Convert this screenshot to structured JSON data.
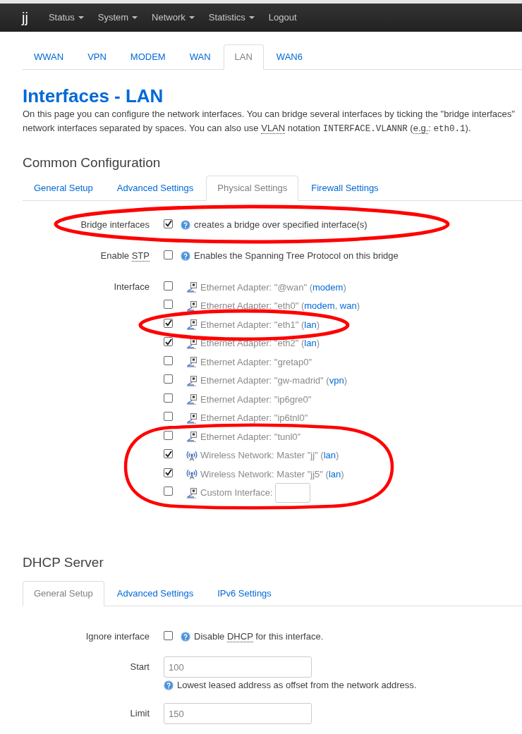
{
  "navbar": {
    "brand": "jj",
    "menu": [
      {
        "label": "Status",
        "dropdown": true
      },
      {
        "label": "System",
        "dropdown": true
      },
      {
        "label": "Network",
        "dropdown": true
      },
      {
        "label": "Statistics",
        "dropdown": true
      },
      {
        "label": "Logout",
        "dropdown": false
      }
    ]
  },
  "interface_tabs": [
    {
      "label": "WWAN",
      "selected": false
    },
    {
      "label": "VPN",
      "selected": false
    },
    {
      "label": "MODEM",
      "selected": false
    },
    {
      "label": "WAN",
      "selected": false
    },
    {
      "label": "LAN",
      "selected": true
    },
    {
      "label": "WAN6",
      "selected": false
    }
  ],
  "page": {
    "title": "Interfaces - LAN",
    "description_lines": [
      [
        {
          "kind": "text",
          "text": "On this page you can configure the network interfaces. You can bridge several interfaces by ticking the \"bridge interfaces\""
        }
      ],
      [
        {
          "kind": "text",
          "text": "network interfaces separated by spaces. You can also use "
        },
        {
          "kind": "abbr",
          "text": "VLAN"
        },
        {
          "kind": "text",
          "text": " notation "
        },
        {
          "kind": "code",
          "text": "INTERFACE.VLANNR"
        },
        {
          "kind": "text",
          "text": " ("
        },
        {
          "kind": "abbr",
          "text": "e.g."
        },
        {
          "kind": "text",
          "text": ": "
        },
        {
          "kind": "code",
          "text": "eth0.1"
        },
        {
          "kind": "text",
          "text": ")."
        }
      ]
    ]
  },
  "sections": [
    {
      "heading": "Common Configuration",
      "tabs": [
        {
          "label": "General Setup",
          "selected": false
        },
        {
          "label": "Advanced Settings",
          "selected": false
        },
        {
          "label": "Physical Settings",
          "selected": true
        },
        {
          "label": "Firewall Settings",
          "selected": false
        }
      ],
      "fields": [
        {
          "kind": "checkbox",
          "label": [
            {
              "kind": "text",
              "text": "Bridge interfaces"
            }
          ],
          "checked": true,
          "help": [
            {
              "kind": "text",
              "text": "creates a bridge over specified interface(s)"
            }
          ]
        },
        {
          "kind": "checkbox",
          "label": [
            {
              "kind": "text",
              "text": "Enable "
            },
            {
              "kind": "abbr",
              "text": "STP"
            }
          ],
          "checked": false,
          "help": [
            {
              "kind": "text",
              "text": "Enables the Spanning Tree Protocol on this bridge"
            }
          ]
        },
        {
          "kind": "interface_list",
          "label": [
            {
              "kind": "text",
              "text": "Interface"
            }
          ],
          "options": [
            {
              "kind": "ethernet",
              "checked": false,
              "text": [
                {
                  "kind": "text",
                  "text": "Ethernet Adapter: \"@wan\" ("
                },
                {
                  "kind": "link",
                  "text": "modem"
                },
                {
                  "kind": "text",
                  "text": ")"
                }
              ]
            },
            {
              "kind": "ethernet",
              "checked": false,
              "text": [
                {
                  "kind": "text",
                  "text": "Ethernet Adapter: \"eth0\" ("
                },
                {
                  "kind": "link",
                  "text": "modem"
                },
                {
                  "kind": "text",
                  "text": ", "
                },
                {
                  "kind": "link",
                  "text": "wan"
                },
                {
                  "kind": "text",
                  "text": ")"
                }
              ]
            },
            {
              "kind": "ethernet",
              "checked": true,
              "text": [
                {
                  "kind": "text",
                  "text": "Ethernet Adapter: \"eth1\" ("
                },
                {
                  "kind": "link",
                  "text": "lan"
                },
                {
                  "kind": "text",
                  "text": ")"
                }
              ]
            },
            {
              "kind": "ethernet",
              "checked": true,
              "text": [
                {
                  "kind": "text",
                  "text": "Ethernet Adapter: \"eth2\" ("
                },
                {
                  "kind": "link",
                  "text": "lan"
                },
                {
                  "kind": "text",
                  "text": ")"
                }
              ]
            },
            {
              "kind": "ethernet",
              "checked": false,
              "text": [
                {
                  "kind": "text",
                  "text": "Ethernet Adapter: \"gretap0\""
                }
              ]
            },
            {
              "kind": "ethernet",
              "checked": false,
              "text": [
                {
                  "kind": "text",
                  "text": "Ethernet Adapter: \"gw-madrid\" ("
                },
                {
                  "kind": "link",
                  "text": "vpn"
                },
                {
                  "kind": "text",
                  "text": ")"
                }
              ]
            },
            {
              "kind": "ethernet",
              "checked": false,
              "text": [
                {
                  "kind": "text",
                  "text": "Ethernet Adapter: \"ip6gre0\""
                }
              ]
            },
            {
              "kind": "ethernet",
              "checked": false,
              "text": [
                {
                  "kind": "text",
                  "text": "Ethernet Adapter: \"ip6tnl0\""
                }
              ]
            },
            {
              "kind": "ethernet",
              "checked": false,
              "text": [
                {
                  "kind": "text",
                  "text": "Ethernet Adapter: \"tunl0\""
                }
              ]
            },
            {
              "kind": "wireless",
              "checked": true,
              "text": [
                {
                  "kind": "text",
                  "text": "Wireless Network: Master \"jj\" ("
                },
                {
                  "kind": "link",
                  "text": "lan"
                },
                {
                  "kind": "text",
                  "text": ")"
                }
              ]
            },
            {
              "kind": "wireless",
              "checked": true,
              "text": [
                {
                  "kind": "text",
                  "text": "Wireless Network: Master \"jj5\" ("
                },
                {
                  "kind": "link",
                  "text": "lan"
                },
                {
                  "kind": "text",
                  "text": ")"
                }
              ]
            },
            {
              "kind": "custom",
              "checked": false,
              "text": [
                {
                  "kind": "text",
                  "text": "Custom Interface:"
                }
              ]
            }
          ]
        }
      ]
    },
    {
      "heading": "DHCP Server",
      "tabs": [
        {
          "label": "General Setup",
          "selected": true
        },
        {
          "label": "Advanced Settings",
          "selected": false
        },
        {
          "label": "IPv6 Settings",
          "selected": false
        }
      ],
      "fields": [
        {
          "kind": "checkbox",
          "label": [
            {
              "kind": "text",
              "text": "Ignore interface"
            }
          ],
          "checked": false,
          "help": [
            {
              "kind": "text",
              "text": "Disable "
            },
            {
              "kind": "abbr",
              "text": "DHCP"
            },
            {
              "kind": "text",
              "text": " for this interface."
            }
          ]
        },
        {
          "kind": "text",
          "label": [
            {
              "kind": "text",
              "text": "Start"
            }
          ],
          "value": "100",
          "help": [
            {
              "kind": "text",
              "text": "Lowest leased address as offset from the network address."
            }
          ]
        },
        {
          "kind": "text",
          "label": [
            {
              "kind": "text",
              "text": "Limit"
            }
          ],
          "value": "150"
        }
      ]
    }
  ]
}
